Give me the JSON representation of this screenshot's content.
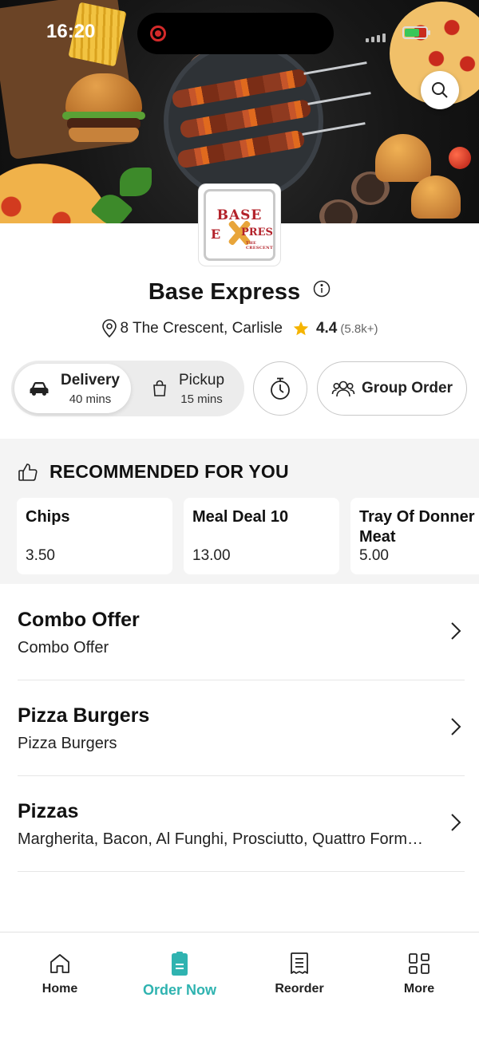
{
  "status_bar": {
    "time": "16:20"
  },
  "restaurant": {
    "name": "Base Express",
    "address": "8 The Crescent, Carlisle",
    "rating": "4.4",
    "rating_count": "(5.8k+)",
    "logo": {
      "line1": "BASE",
      "line2_left": "E",
      "line2_right": "PRESS",
      "tagline": "THE CRESCENT"
    }
  },
  "order_mode": {
    "delivery": {
      "label": "Delivery",
      "time": "40 mins",
      "selected": true
    },
    "pickup": {
      "label": "Pickup",
      "time": "15 mins",
      "selected": false
    }
  },
  "group_order_label": "Group Order",
  "recommended": {
    "title": "RECOMMENDED FOR YOU",
    "items": [
      {
        "name": "Chips",
        "price": "3.50"
      },
      {
        "name": "Meal Deal 10",
        "price": "13.00"
      },
      {
        "name": "Tray Of Donner Meat",
        "price": "5.00"
      }
    ]
  },
  "categories": [
    {
      "title": "Combo Offer",
      "description": "Combo Offer"
    },
    {
      "title": "Pizza Burgers",
      "description": "Pizza Burgers"
    },
    {
      "title": "Pizzas",
      "description": "Margherita, Bacon, Al Funghi, Prosciutto, Quattro Formaggi"
    }
  ],
  "bottom_nav": [
    {
      "label": "Home",
      "icon": "home-icon",
      "active": false
    },
    {
      "label": "Order Now",
      "icon": "order-icon",
      "active": true
    },
    {
      "label": "Reorder",
      "icon": "receipt-icon",
      "active": false
    },
    {
      "label": "More",
      "icon": "grid-icon",
      "active": false
    }
  ],
  "colors": {
    "accent": "#2fb3b0",
    "star": "#f5b400",
    "recording": "#d42a2a"
  }
}
